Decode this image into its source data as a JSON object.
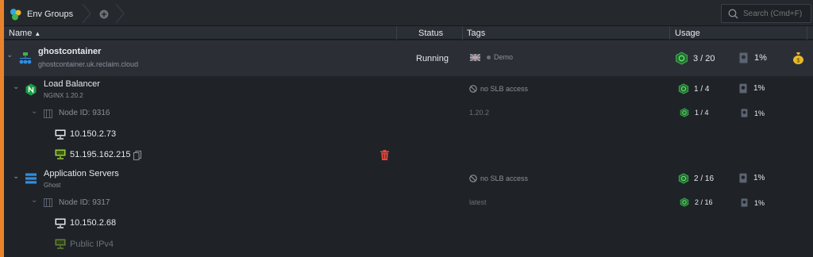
{
  "toolbar": {
    "env_groups_tab": "Env Groups",
    "search_placeholder": "Search (Cmd+F)"
  },
  "columns": {
    "name": "Name",
    "status": "Status",
    "tags": "Tags",
    "usage": "Usage"
  },
  "environment": {
    "name": "ghostcontainer",
    "domain": "ghostcontainer.uk.reclaim.cloud",
    "status": "Running",
    "tag": "Demo",
    "cloudlets": "3 / 20",
    "disk": "1%"
  },
  "load_balancer": {
    "name": "Load Balancer",
    "version": "NGINX 1.20.2",
    "tag": "no SLB access",
    "cloudlets": "1 / 4",
    "disk": "1%",
    "node": {
      "id": "Node ID: 9316",
      "tag": "1.20.2",
      "cloudlets": "1 / 4",
      "disk": "1%",
      "private_ip": "10.150.2.73",
      "public_ip": "51.195.162.215"
    }
  },
  "app_servers": {
    "name": "Application Servers",
    "stack": "Ghost",
    "tag": "no SLB access",
    "cloudlets": "2 / 16",
    "disk": "1%",
    "node": {
      "id": "Node ID: 9317",
      "tag": "latest",
      "cloudlets": "2 / 16",
      "disk": "1%",
      "private_ip": "10.150.2.68",
      "public_ip_placeholder": "Public IPv4"
    }
  },
  "colors": {
    "accent_orange": "#e8832b",
    "cloudlet_green": "#3fb34f",
    "delete_red": "#e5483d",
    "nginx_green": "#1a9d46",
    "server_blue": "#2f8ee0"
  }
}
